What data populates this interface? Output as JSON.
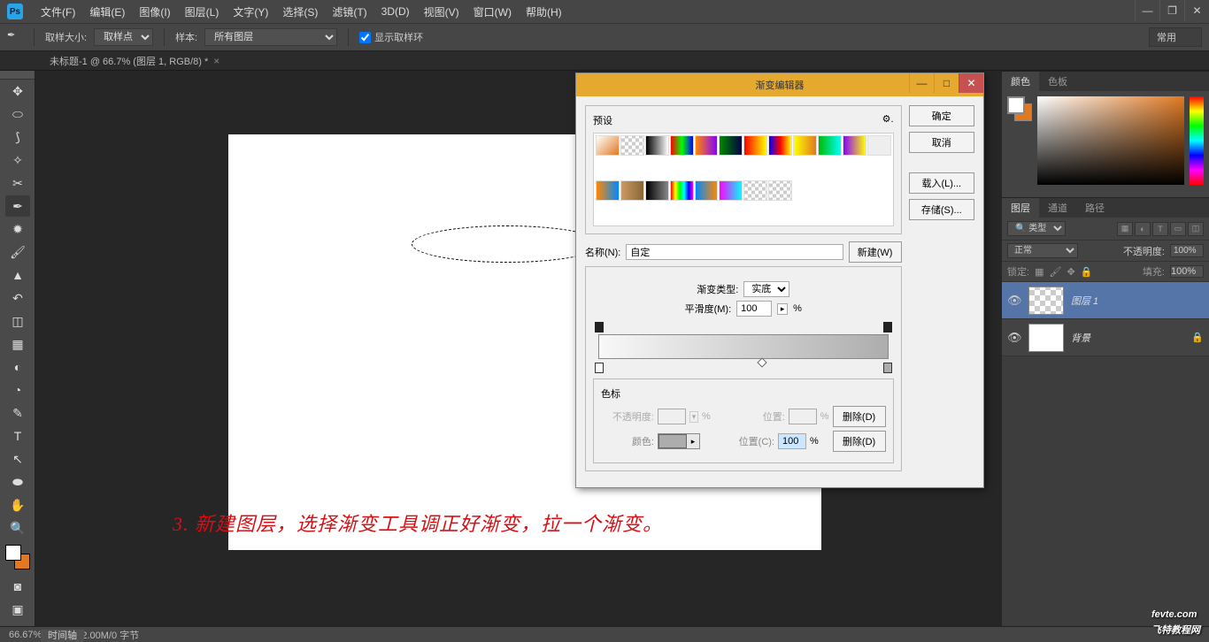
{
  "menu": {
    "items": [
      "文件(F)",
      "编辑(E)",
      "图像(I)",
      "图层(L)",
      "文字(Y)",
      "选择(S)",
      "滤镜(T)",
      "3D(D)",
      "视图(V)",
      "窗口(W)",
      "帮助(H)"
    ]
  },
  "options": {
    "sample_size_label": "取样大小:",
    "sample_size_value": "取样点",
    "sample_label": "样本:",
    "sample_value": "所有图层",
    "show_ring": "显示取样环",
    "mode_value": "常用"
  },
  "doc_tab": "未标题-1 @ 66.7% (图层 1, RGB/8) *",
  "panels": {
    "color_tabs": [
      "颜色",
      "色板"
    ],
    "layer_tabs": [
      "图层",
      "通道",
      "路径"
    ],
    "filter_kind": "类型",
    "blend_mode": "正常",
    "opacity_label": "不透明度:",
    "opacity_value": "100%",
    "lock_label": "锁定:",
    "fill_label": "填充:",
    "fill_value": "100%",
    "layers": [
      {
        "name": "图层 1",
        "selected": true,
        "thumb": "check",
        "locked": false
      },
      {
        "name": "背景",
        "selected": false,
        "thumb": "white",
        "locked": true
      }
    ]
  },
  "dialog": {
    "title": "渐变编辑器",
    "preset_label": "预设",
    "ok": "确定",
    "cancel": "取消",
    "load": "载入(L)...",
    "save": "存储(S)...",
    "name_label": "名称(N):",
    "name_value": "自定",
    "new_btn": "新建(W)",
    "grad_type_label": "渐变类型:",
    "grad_type_value": "实底",
    "smooth_label": "平滑度(M):",
    "smooth_value": "100",
    "stops_label": "色标",
    "opacity_label": "不透明度:",
    "position_label": "位置:",
    "color_label": "颜色:",
    "position2_label": "位置(C):",
    "position2_value": "100",
    "delete_label": "删除(D)",
    "percent": "%"
  },
  "status": {
    "zoom": "66.67%",
    "doc_info": "文档:2.00M/0 字节",
    "timeline": "时间轴"
  },
  "annotation": "3. 新建图层，选择渐变工具调正好渐变，拉一个渐变。",
  "watermark": {
    "main": "fevte.com",
    "sub": "飞特教程网"
  }
}
